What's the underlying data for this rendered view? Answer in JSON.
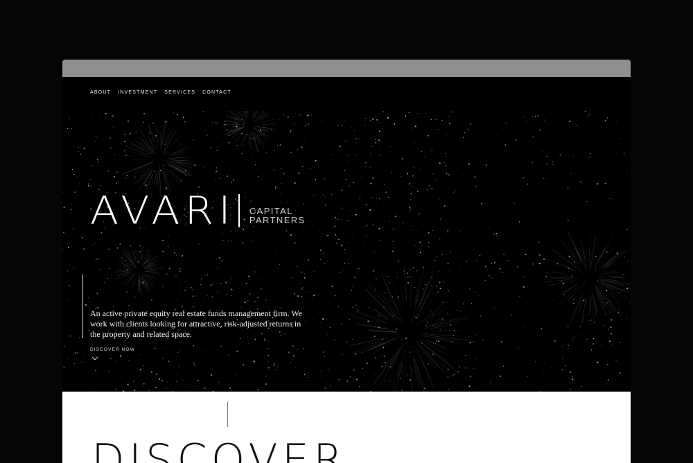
{
  "nav": {
    "items": [
      "ABOUT",
      "INVESTMENT",
      "SERVICES",
      "CONTACT"
    ]
  },
  "hero": {
    "brand_name": "AVARI",
    "brand_sub_line1": "CAPITAL",
    "brand_sub_line2": "PARTNERS",
    "tagline": "An active private equity real estate funds management firm. We work with clients looking for attractive, risk-adjusted returns in the property and related space.",
    "cta_label": "DISCOVER NOW",
    "cta_icon": "chevron-down-icon"
  },
  "section": {
    "heading": "DISCOVER"
  },
  "colors": {
    "page_bg": "#050505",
    "browser_bar": "#8f8f8f",
    "hero_bg": "#000000",
    "section_bg": "#ffffff"
  }
}
